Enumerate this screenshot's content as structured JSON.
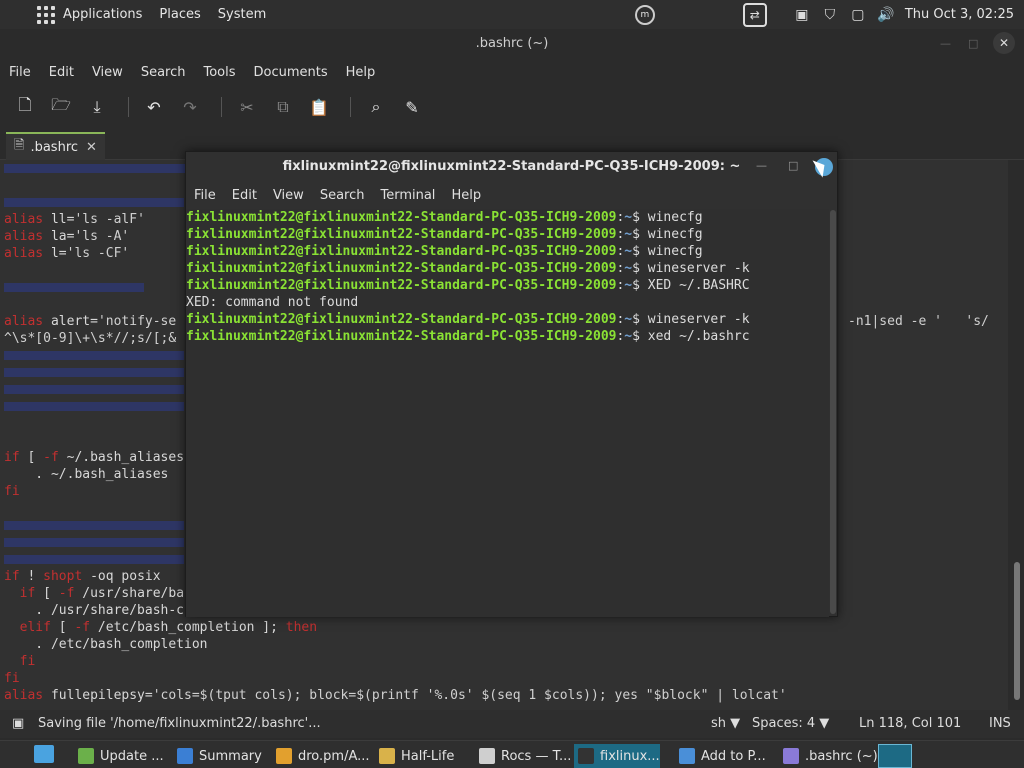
{
  "topbar": {
    "menus": [
      "Applications",
      "Places",
      "System"
    ],
    "clock": "Thu Oct  3, 02:25"
  },
  "xed": {
    "title": ".bashrc (~)",
    "menu": [
      "File",
      "Edit",
      "View",
      "Search",
      "Tools",
      "Documents",
      "Help"
    ],
    "tab": ".bashrc",
    "lines": [
      [
        {
          "t": "alias",
          "c": "red"
        },
        {
          "t": " ll=",
          "c": "pl"
        },
        {
          "t": "'ls -alF'",
          "c": "str"
        }
      ],
      [
        {
          "t": "alias",
          "c": "red"
        },
        {
          "t": " la=",
          "c": "pl"
        },
        {
          "t": "'ls -A'",
          "c": "str"
        }
      ],
      [
        {
          "t": "alias",
          "c": "red"
        },
        {
          "t": " l=",
          "c": "pl"
        },
        {
          "t": "'ls -CF'",
          "c": "str"
        }
      ],
      [
        {
          "t": "alias",
          "c": "red"
        },
        {
          "t": " alert=",
          "c": "pl"
        },
        {
          "t": "'notify-se",
          "c": "str"
        }
      ],
      [
        {
          "t": "^\\s*[0-9]\\+\\s*//;s/[;&",
          "c": "str"
        }
      ],
      [
        {
          "t": "if",
          "c": "red"
        },
        {
          "t": " [ ",
          "c": "pl"
        },
        {
          "t": "-f",
          "c": "red"
        },
        {
          "t": " ~/.bash_aliases",
          "c": "pl"
        }
      ],
      [
        {
          "t": "    . ",
          "c": "pl"
        },
        {
          "t": "~/.bash_aliases",
          "c": "pl"
        }
      ],
      [
        {
          "t": "fi",
          "c": "red"
        }
      ],
      [
        {
          "t": "if",
          "c": "red"
        },
        {
          "t": " ! ",
          "c": "pl"
        },
        {
          "t": "shopt",
          "c": "red"
        },
        {
          "t": " -oq posix",
          "c": "pl"
        }
      ],
      [
        {
          "t": "  if",
          "c": "red"
        },
        {
          "t": " [ ",
          "c": "pl"
        },
        {
          "t": "-f",
          "c": "red"
        },
        {
          "t": " /usr/share/ba",
          "c": "pl"
        }
      ],
      [
        {
          "t": "    . /usr/share/bash-c",
          "c": "pl"
        }
      ],
      [
        {
          "t": "  elif",
          "c": "red"
        },
        {
          "t": " [ ",
          "c": "pl"
        },
        {
          "t": "-f",
          "c": "red"
        },
        {
          "t": " /etc/bash_completion ]; ",
          "c": "pl"
        },
        {
          "t": "then",
          "c": "red"
        }
      ],
      [
        {
          "t": "    . /etc/bash_completion",
          "c": "pl"
        }
      ],
      [
        {
          "t": "  fi",
          "c": "red"
        }
      ],
      [
        {
          "t": "fi",
          "c": "red"
        }
      ],
      [
        {
          "t": "alias",
          "c": "red"
        },
        {
          "t": " fullepilepsy=",
          "c": "pl"
        },
        {
          "t": "'cols=$(tput cols); block=$(printf '%.0s' $(seq 1 $cols)); yes \"$block\" | lolcat'",
          "c": "str"
        }
      ]
    ],
    "right_fragment": "-n1|sed -e '   's/",
    "status": {
      "message": "Saving file '/home/fixlinuxmint22/.bashrc'...",
      "lang": "sh",
      "spaces": "Spaces: 4",
      "position": "Ln 118, Col 101",
      "mode": "INS"
    }
  },
  "terminal": {
    "title": "fixlinuxmint22@fixlinuxmint22-Standard-PC-Q35-ICH9-2009: ~",
    "menu": [
      "File",
      "Edit",
      "View",
      "Search",
      "Terminal",
      "Help"
    ],
    "prompt": "fixlinuxmint22@fixlinuxmint22-Standard-PC-Q35-ICH9-2009",
    "lines": [
      {
        "type": "cmd",
        "cmd": "winecfg"
      },
      {
        "type": "cmd",
        "cmd": "winecfg"
      },
      {
        "type": "cmd",
        "cmd": "winecfg"
      },
      {
        "type": "cmd",
        "cmd": "wineserver -k"
      },
      {
        "type": "cmd",
        "cmd": "XED ~/.BASHRC"
      },
      {
        "type": "out",
        "text": "XED: command not found"
      },
      {
        "type": "cmd",
        "cmd": "wineserver -k"
      },
      {
        "type": "cmd",
        "cmd": "xed ~/.bashrc"
      }
    ]
  },
  "taskbar": [
    {
      "label": "Update ...",
      "color": "#6bb04a"
    },
    {
      "label": "Summary",
      "color": "#3b7fd4"
    },
    {
      "label": "dro.pm/A...",
      "color": "#e2a02e"
    },
    {
      "label": "Half-Life",
      "color": "#d9b24a"
    },
    {
      "label": "Rocs — T...",
      "color": "#cfcfcf"
    },
    {
      "label": "fixlinux...",
      "color": "#333"
    },
    {
      "label": "Add to P...",
      "color": "#4a8fd8"
    },
    {
      "label": ".bashrc (~)",
      "color": "#8a7ad8"
    }
  ]
}
